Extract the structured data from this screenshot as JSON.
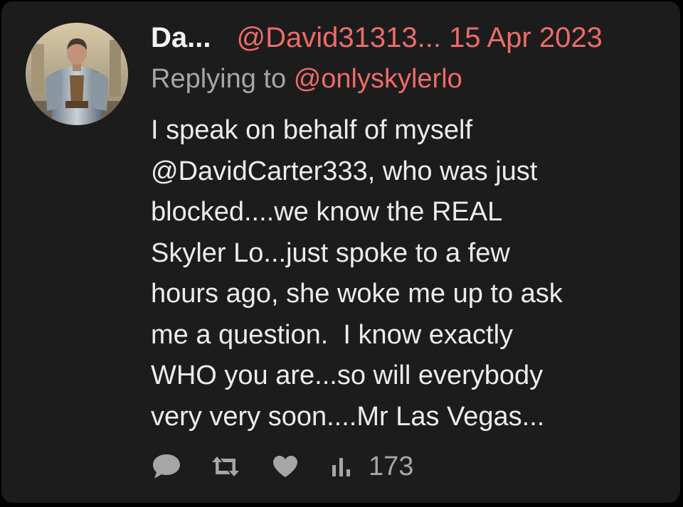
{
  "tweet": {
    "display_name": "Da...",
    "handle": "@David31313...",
    "date": "15 Apr 2023",
    "replying_label": "Replying to",
    "replying_to": "@onlyskylerlo",
    "body_lines": [
      "I speak on behalf of myself",
      "@DavidCarter333, who was just",
      "blocked....we know the REAL",
      "Skyler Lo...just spoke to a few",
      "hours ago, she woke me up to ask",
      "me a question.  I know exactly",
      "WHO you are...so will everybody",
      "very very soon....Mr Las Vegas..."
    ]
  },
  "actions": {
    "reply_icon": "speech-bubble-icon",
    "retweet_icon": "retweet-icon",
    "like_icon": "heart-icon",
    "views_icon": "bar-chart-icon",
    "view_count": "173"
  },
  "colors": {
    "background": "#000000",
    "card": "#1c1c1c",
    "accent": "#ef6a6a",
    "text": "#ececec",
    "muted": "#a6a6a6"
  }
}
